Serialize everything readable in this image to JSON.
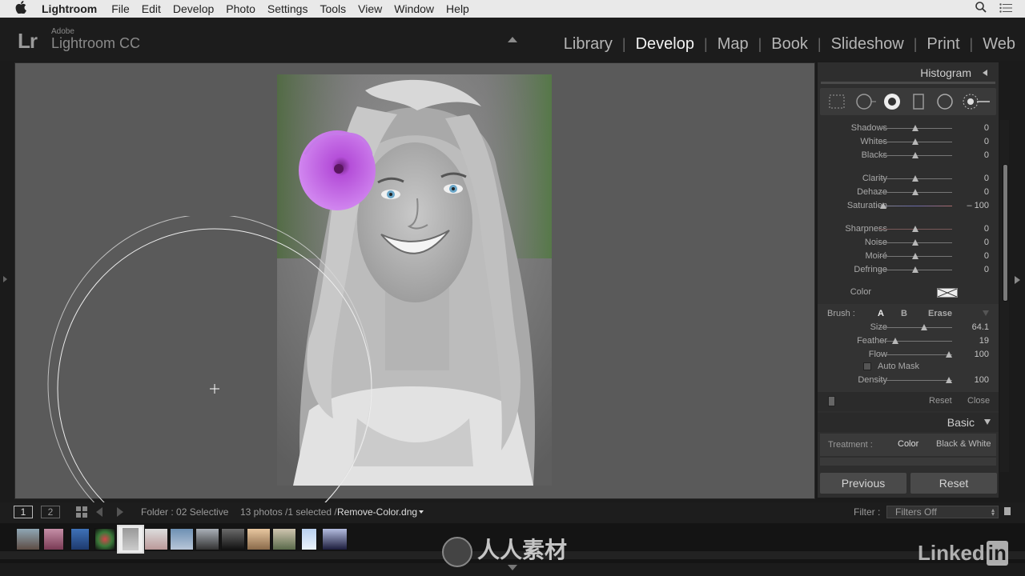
{
  "menubar": {
    "items": [
      "Lightroom",
      "File",
      "Edit",
      "Develop",
      "Photo",
      "Settings",
      "Tools",
      "View",
      "Window",
      "Help"
    ],
    "icons": [
      "apple-icon",
      "search-icon",
      "list-icon"
    ]
  },
  "header": {
    "brand_small": "Adobe",
    "brand_name": "Lightroom CC",
    "logo": "Lr",
    "modules": [
      "Library",
      "Develop",
      "Map",
      "Book",
      "Slideshow",
      "Print",
      "Web"
    ],
    "active_module": "Develop"
  },
  "panel": {
    "histogram_label": "Histogram",
    "tools": [
      "crop-overlay-icon",
      "spot-removal-icon",
      "red-eye-icon",
      "graduated-filter-icon",
      "radial-filter-icon",
      "adjustment-brush-icon"
    ],
    "sliders_a": [
      {
        "label": "Shadows",
        "value": "0",
        "pos": 0.5
      },
      {
        "label": "Whites",
        "value": "0",
        "pos": 0.5
      },
      {
        "label": "Blacks",
        "value": "0",
        "pos": 0.5
      }
    ],
    "sliders_b": [
      {
        "label": "Clarity",
        "value": "0",
        "pos": 0.5
      },
      {
        "label": "Dehaze",
        "value": "0",
        "pos": 0.5
      },
      {
        "label": "Saturation",
        "value": "– 100",
        "pos": 0.0
      }
    ],
    "sliders_c": [
      {
        "label": "Sharpness",
        "value": "0",
        "pos": 0.5
      },
      {
        "label": "Noise",
        "value": "0",
        "pos": 0.5
      },
      {
        "label": "Moiré",
        "value": "0",
        "pos": 0.5
      },
      {
        "label": "Defringe",
        "value": "0",
        "pos": 0.5
      }
    ],
    "color_label": "Color",
    "brush": {
      "label": "Brush :",
      "a": "A",
      "b": "B",
      "erase": "Erase",
      "sliders": [
        {
          "label": "Size",
          "value": "64.1",
          "pos": 0.641
        },
        {
          "label": "Feather",
          "value": "19",
          "pos": 0.19
        },
        {
          "label": "Flow",
          "value": "100",
          "pos": 1.0
        }
      ],
      "auto_mask": "Auto Mask",
      "density": {
        "label": "Density",
        "value": "100",
        "pos": 1.0
      }
    },
    "reset": "Reset",
    "close": "Close",
    "basic_label": "Basic",
    "treatment_label": "Treatment :",
    "treatment_color": "Color",
    "treatment_bw": "Black & White",
    "previous_button": "Previous",
    "reset_button": "Reset"
  },
  "toolbar": {
    "view1": "1",
    "view2": "2",
    "folder": "Folder : 02 Selective",
    "count": "13 photos /1 selected /",
    "filename": "Remove-Color.dng",
    "filter_label": "Filter :",
    "filter_value": "Filters Off"
  },
  "watermark": {
    "site": "人人素材",
    "linkedin": "Linked",
    "in": "in"
  }
}
